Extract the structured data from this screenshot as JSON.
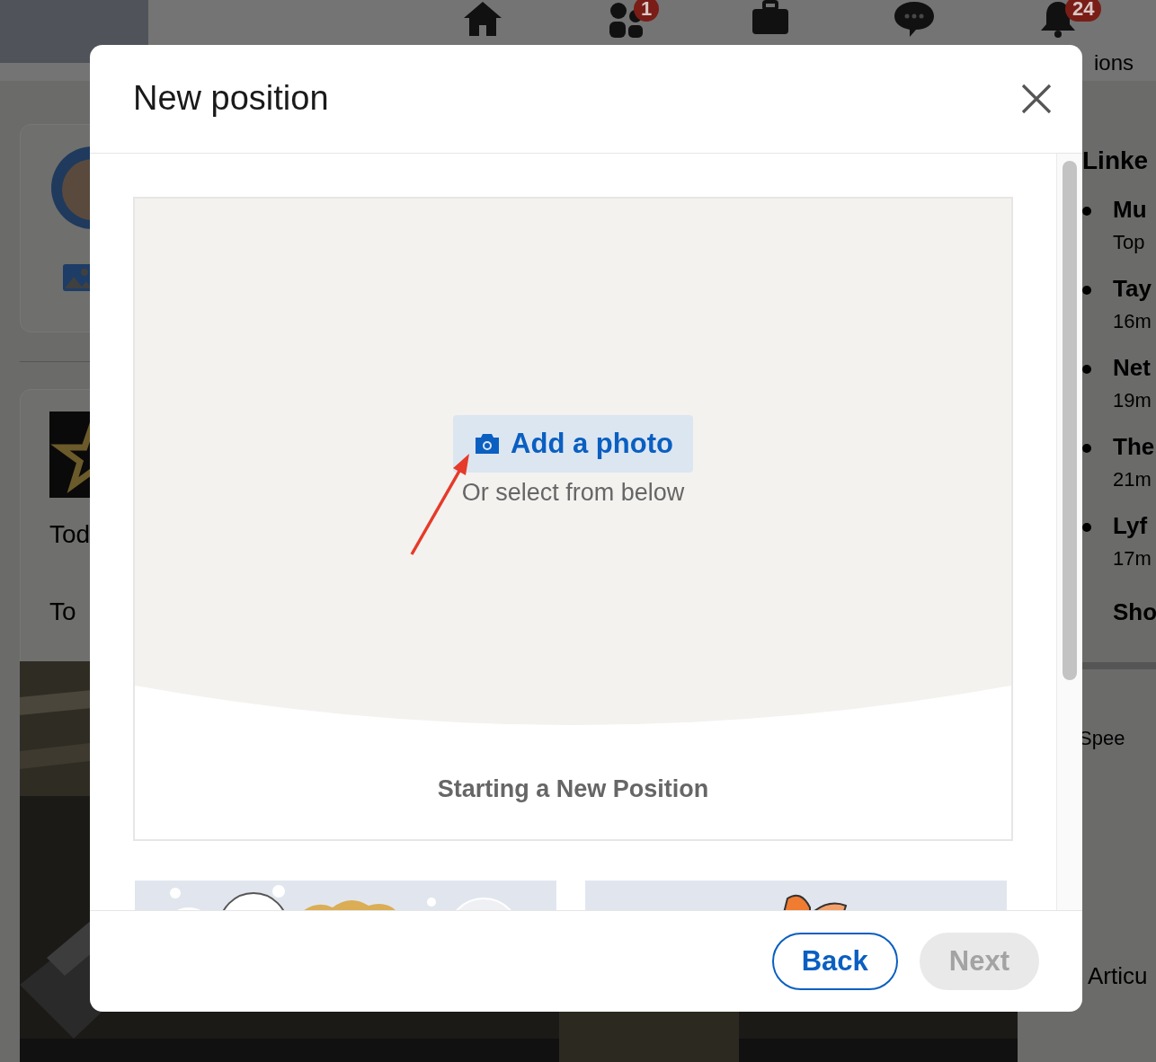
{
  "top_nav": {
    "items": [
      {
        "kind": "home"
      },
      {
        "kind": "people",
        "badge": "1"
      },
      {
        "kind": "briefcase"
      },
      {
        "kind": "chat"
      },
      {
        "kind": "bell",
        "badge": "24",
        "label": "ions"
      }
    ]
  },
  "left_feed": {
    "post_lines": [
      "Tod",
      "To"
    ]
  },
  "right_panel": {
    "title": "Linke",
    "news": [
      {
        "headline": "Mu",
        "meta": "Top"
      },
      {
        "headline": "Tay",
        "meta": "16m"
      },
      {
        "headline": "Net",
        "meta": "19m"
      },
      {
        "headline": "The",
        "meta": "21m"
      },
      {
        "headline": "Lyf",
        "meta": "17m"
      }
    ],
    "show_more": "Sho",
    "card_text": "Spee",
    "footer_text": "Articu"
  },
  "modal": {
    "title": "New position",
    "photo_area": {
      "add_button": "Add a photo",
      "hint": "Or select from below",
      "caption": "Starting a New Position"
    },
    "buttons": [
      {
        "label": "Back",
        "disabled": false
      },
      {
        "label": "Next",
        "disabled": true
      }
    ]
  }
}
